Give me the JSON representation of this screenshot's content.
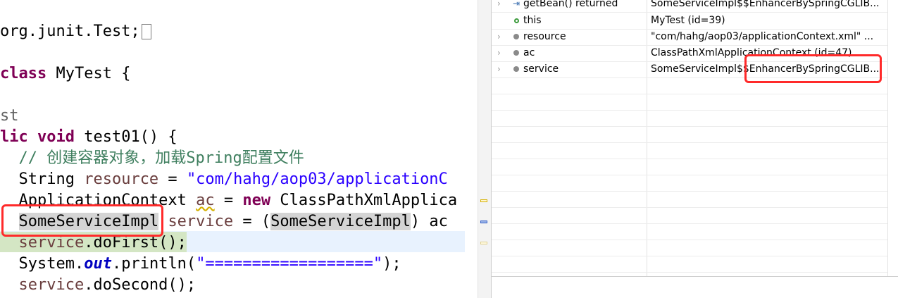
{
  "editor": {
    "lines": {
      "l1": "org.junit.Test;",
      "l2_kw": "class",
      "l2_rest": " MyTest {",
      "l3": "st",
      "l4_a": "lic ",
      "l4_kw": "void",
      "l4_rest": " test01() {",
      "l5": "  // 创建容器对象，加载Spring配置文件",
      "l6_a": "  String ",
      "l6_var": "resource",
      "l6_b": " = ",
      "l6_str": "\"com/hahg/aop03/applicationC",
      "l7_a": "  ApplicationContext ",
      "l7_var": "ac",
      "l7_b": " = ",
      "l7_kw": "new",
      "l7_rest": " ClassPathXmlApplica",
      "l8_type": "SomeServiceImpl",
      "l8_var": "service",
      "l8_b": " = (",
      "l8_type2": "SomeServiceImpl",
      "l8_rest": ") ac",
      "l9_var": "service",
      "l9_rest": ".doFirst();",
      "l10_a": "  System.",
      "l10_out": "out",
      "l10_b": ".println(",
      "l10_str": "\"==================\"",
      "l10_c": ");",
      "l11_var": "service",
      "l11_rest": ".doSecond();"
    }
  },
  "variables": {
    "rows": [
      {
        "name": "getBean() returned",
        "value": "SomeServiceImpl$$EnhancerBySpringCGLIB...",
        "expandable": true,
        "icon": "method-return-icon"
      },
      {
        "name": "this",
        "value": "MyTest  (id=39)",
        "expandable": false,
        "icon": "local-variable-icon"
      },
      {
        "name": "resource",
        "value": "\"com/hahg/aop03/applicationContext.xml\" ...",
        "expandable": true,
        "icon": "field-icon"
      },
      {
        "name": "ac",
        "value": "ClassPathXmlApplicationContext  (id=47)",
        "expandable": true,
        "icon": "field-icon"
      },
      {
        "name": "service",
        "value": "SomeServiceImpl$$EnhancerBySpringCGLIB...",
        "expandable": true,
        "icon": "field-icon"
      }
    ]
  },
  "icons": {
    "expand": "›"
  },
  "colors": {
    "highlight_box": "#ff2a2a",
    "keyword": "#7f0055",
    "string": "#2a00ff",
    "comment": "#3f7f5f",
    "current_line": "#e8f2fe"
  }
}
